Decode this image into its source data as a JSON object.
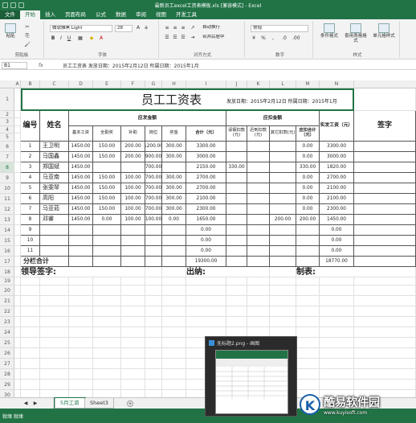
{
  "window": {
    "title": "最新员工excel工资表模板.xls  [兼容模式] - Excel"
  },
  "tabs": [
    {
      "label": "文件"
    },
    {
      "label": "开始"
    },
    {
      "label": "插入"
    },
    {
      "label": "页面布局"
    },
    {
      "label": "公式"
    },
    {
      "label": "数据"
    },
    {
      "label": "审阅"
    },
    {
      "label": "视图"
    },
    {
      "label": "开发工具"
    }
  ],
  "ribbon": {
    "clipboard": "剪贴板",
    "paste": "粘贴",
    "font_group": "字体",
    "font_name": "微软雅黑 Light",
    "font_size": "28",
    "align_group": "对齐方式",
    "wrap": "自动换行",
    "merge": "合并后居中",
    "number_group": "数字",
    "number_format": "常规",
    "styles_group": "样式",
    "cond_format": "条件格式",
    "table_format": "套用表格格式",
    "cell_styles": "单元格样式"
  },
  "formula_bar": {
    "name_box": "B1",
    "fx": "fx",
    "content": "员工工资表  发放日期：2015年2月12日  所属日期：2015年1月"
  },
  "columns": [
    "A",
    "B",
    "C",
    "D",
    "E",
    "F",
    "G",
    "H",
    "I",
    "J",
    "K",
    "L",
    "M",
    "N"
  ],
  "rows": [
    "1",
    "2",
    "3",
    "4",
    "5",
    "6",
    "7",
    "8",
    "9",
    "10",
    "11",
    "12",
    "13",
    "14",
    "15",
    "16",
    "17",
    "18",
    "19",
    "20",
    "21",
    "22",
    "23",
    "24",
    "25",
    "26",
    "27",
    "28",
    "29",
    "30"
  ],
  "sheet": {
    "title": "员工工资表",
    "date_info": "发放日期：2015年2月12日  所属日期：2015年1月",
    "hdr_no": "编号",
    "hdr_name": "姓名",
    "hdr_pay": "应发金额",
    "hdr_deduct": "应扣金额",
    "hdr_net": "实发工资（元）",
    "hdr_sign": "签字",
    "sub": [
      "基本工资",
      "全勤奖",
      "补助",
      "岗位",
      "奖金",
      "合计（元）",
      "请假扣款(元)",
      "迟到扣款(元)",
      "其它扣款(元)",
      "应扣合计（元）"
    ],
    "data": [
      [
        "1",
        "王卫明",
        "1450.00",
        "150.00",
        "200.00",
        "1200.00",
        "300.00",
        "3300.00",
        "",
        "",
        "",
        "0.00",
        "3300.00"
      ],
      [
        "2",
        "马国鑫",
        "1450.00",
        "150.00",
        "200.00",
        "900.00",
        "300.00",
        "3000.00",
        "",
        "",
        "",
        "0.00",
        "3000.00"
      ],
      [
        "3",
        "郑国斌",
        "1450.00",
        "",
        "",
        "700.00",
        "",
        "2150.00",
        "330.00",
        "",
        "",
        "330.00",
        "1820.00"
      ],
      [
        "4",
        "马亚南",
        "1450.00",
        "150.00",
        "100.00",
        "700.00",
        "300.00",
        "2700.00",
        "",
        "",
        "",
        "0.00",
        "2700.00"
      ],
      [
        "5",
        "张雯琴",
        "1450.00",
        "150.00",
        "100.00",
        "700.00",
        "300.00",
        "2700.00",
        "",
        "",
        "",
        "0.00",
        "2100.00"
      ],
      [
        "6",
        "高阳",
        "1450.00",
        "150.00",
        "100.00",
        "700.00",
        "300.00",
        "2100.00",
        "",
        "",
        "",
        "0.00",
        "2100.00"
      ],
      [
        "7",
        "马亚茹",
        "1450.00",
        "150.00",
        "100.00",
        "700.00",
        "300.00",
        "2300.00",
        "",
        "",
        "",
        "0.00",
        "2300.00"
      ],
      [
        "8",
        "邓睿",
        "1450.00",
        "0.00",
        "100.00",
        "100.00",
        "0.00",
        "1650.00",
        "",
        "",
        "200.00",
        "200.00",
        "1450.00"
      ],
      [
        "9",
        "",
        "",
        "",
        "",
        "",
        "",
        "0.00",
        "",
        "",
        "",
        "",
        "0.00"
      ],
      [
        "10",
        "",
        "",
        "",
        "",
        "",
        "",
        "0.00",
        "",
        "",
        "",
        "",
        "0.00"
      ],
      [
        "11",
        "",
        "",
        "",
        "",
        "",
        "",
        "0.00",
        "",
        "",
        "",
        "",
        "0.00"
      ]
    ],
    "total_label": "分栏合计",
    "total_gross": "19300.00",
    "total_net": "18770.00",
    "leader_sign": "领导签字:",
    "cashier": "出纳:",
    "preparer": "制表:"
  },
  "sheet_tabs": [
    {
      "label": "5月工资"
    },
    {
      "label": "Sheet3"
    }
  ],
  "status": {
    "left": "就绪   就绪"
  },
  "popup": {
    "title": "无标题2.png - 画图"
  },
  "watermark": {
    "brand": "酷易软件园",
    "url": "www.kuyisoft.com"
  },
  "colors": {
    "accent": "#217346"
  }
}
